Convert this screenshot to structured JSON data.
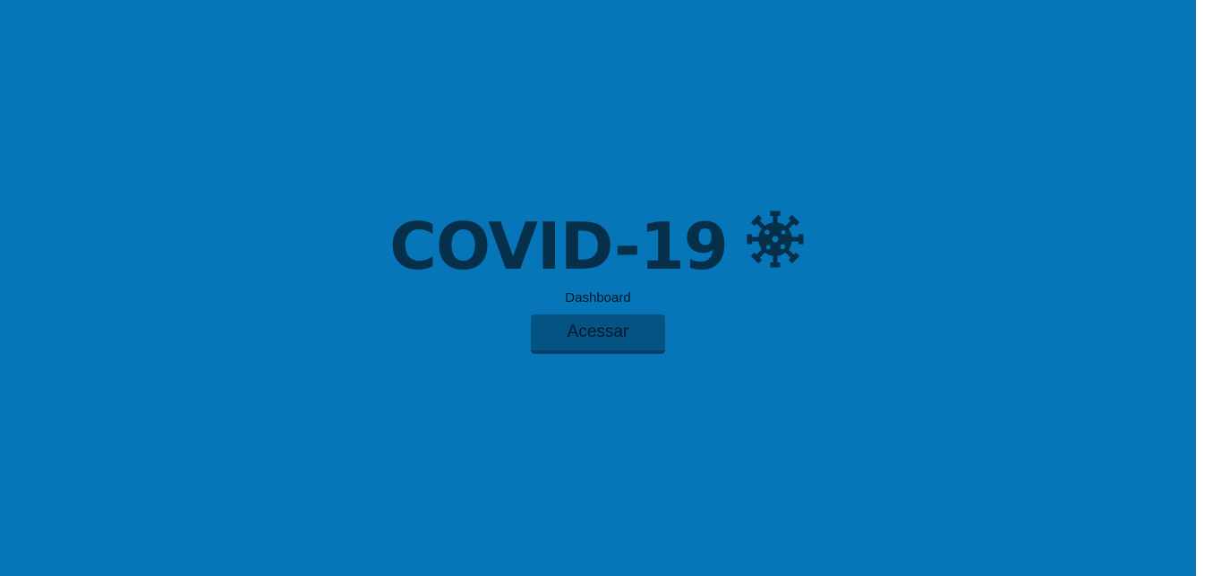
{
  "hero": {
    "title": "COVID-19",
    "subtitle": "Dashboard",
    "access_button_label": "Acessar",
    "icon": "virus-icon"
  },
  "colors": {
    "background": "#0776b9",
    "title": "#06304a",
    "button": "#055383"
  }
}
